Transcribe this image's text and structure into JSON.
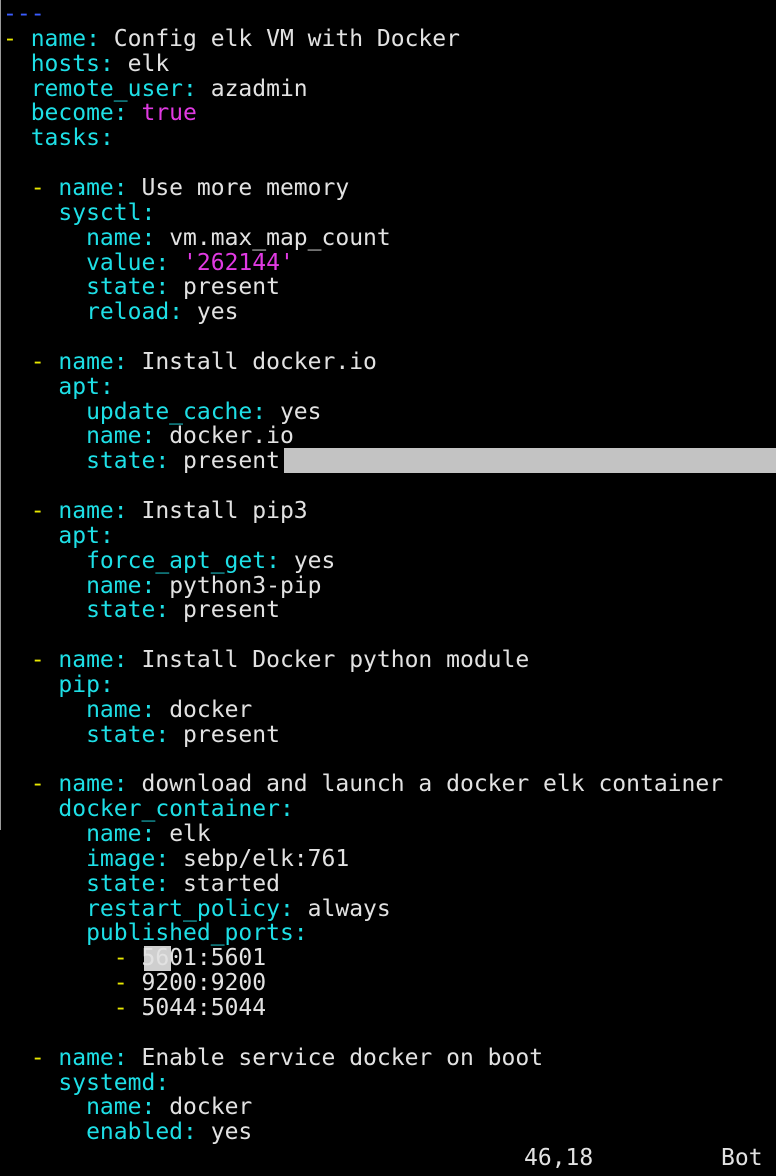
{
  "editor": {
    "lines": [
      [
        {
          "t": "---",
          "c": "doc"
        }
      ],
      [
        {
          "t": "- ",
          "c": "dash"
        },
        {
          "t": "name",
          "c": "key"
        },
        {
          "t": ": ",
          "c": "key"
        },
        {
          "t": "Config elk VM with Docker",
          "c": "val"
        }
      ],
      [
        {
          "t": "  hosts",
          "c": "key"
        },
        {
          "t": ": ",
          "c": "key"
        },
        {
          "t": "elk",
          "c": "val"
        }
      ],
      [
        {
          "t": "  remote_user",
          "c": "key"
        },
        {
          "t": ": ",
          "c": "key"
        },
        {
          "t": "azadmin",
          "c": "val"
        }
      ],
      [
        {
          "t": "  become",
          "c": "key"
        },
        {
          "t": ": ",
          "c": "key"
        },
        {
          "t": "true",
          "c": "bool"
        }
      ],
      [
        {
          "t": "  tasks",
          "c": "key"
        },
        {
          "t": ":",
          "c": "key"
        }
      ],
      [],
      [
        {
          "t": "  - ",
          "c": "dash"
        },
        {
          "t": "name",
          "c": "key"
        },
        {
          "t": ": ",
          "c": "key"
        },
        {
          "t": "Use more memory",
          "c": "val"
        }
      ],
      [
        {
          "t": "    sysctl",
          "c": "key"
        },
        {
          "t": ":",
          "c": "key"
        }
      ],
      [
        {
          "t": "      name",
          "c": "key"
        },
        {
          "t": ": ",
          "c": "key"
        },
        {
          "t": "vm.max_map_count",
          "c": "val"
        }
      ],
      [
        {
          "t": "      value",
          "c": "key"
        },
        {
          "t": ": ",
          "c": "key"
        },
        {
          "t": "'262144'",
          "c": "str"
        }
      ],
      [
        {
          "t": "      state",
          "c": "key"
        },
        {
          "t": ": ",
          "c": "key"
        },
        {
          "t": "present",
          "c": "val"
        }
      ],
      [
        {
          "t": "      reload",
          "c": "key"
        },
        {
          "t": ": ",
          "c": "key"
        },
        {
          "t": "yes",
          "c": "val"
        }
      ],
      [],
      [
        {
          "t": "  - ",
          "c": "dash"
        },
        {
          "t": "name",
          "c": "key"
        },
        {
          "t": ": ",
          "c": "key"
        },
        {
          "t": "Install docker.io",
          "c": "val"
        }
      ],
      [
        {
          "t": "    apt",
          "c": "key"
        },
        {
          "t": ":",
          "c": "key"
        }
      ],
      [
        {
          "t": "      update_cache",
          "c": "key"
        },
        {
          "t": ": ",
          "c": "key"
        },
        {
          "t": "yes",
          "c": "val"
        }
      ],
      [
        {
          "t": "      name",
          "c": "key"
        },
        {
          "t": ": ",
          "c": "key"
        },
        {
          "t": "docker.io",
          "c": "val"
        }
      ],
      [
        {
          "t": "      state",
          "c": "key"
        },
        {
          "t": ": ",
          "c": "key"
        },
        {
          "t": "present",
          "c": "val"
        }
      ],
      [],
      [
        {
          "t": "  - ",
          "c": "dash"
        },
        {
          "t": "name",
          "c": "key"
        },
        {
          "t": ": ",
          "c": "key"
        },
        {
          "t": "Install pip3",
          "c": "val"
        }
      ],
      [
        {
          "t": "    apt",
          "c": "key"
        },
        {
          "t": ":",
          "c": "key"
        }
      ],
      [
        {
          "t": "      force_apt_get",
          "c": "key"
        },
        {
          "t": ": ",
          "c": "key"
        },
        {
          "t": "yes",
          "c": "val"
        }
      ],
      [
        {
          "t": "      name",
          "c": "key"
        },
        {
          "t": ": ",
          "c": "key"
        },
        {
          "t": "python3-pip",
          "c": "val"
        }
      ],
      [
        {
          "t": "      state",
          "c": "key"
        },
        {
          "t": ": ",
          "c": "key"
        },
        {
          "t": "present",
          "c": "val"
        }
      ],
      [],
      [
        {
          "t": "  - ",
          "c": "dash"
        },
        {
          "t": "name",
          "c": "key"
        },
        {
          "t": ": ",
          "c": "key"
        },
        {
          "t": "Install Docker python module",
          "c": "val"
        }
      ],
      [
        {
          "t": "    pip",
          "c": "key"
        },
        {
          "t": ":",
          "c": "key"
        }
      ],
      [
        {
          "t": "      name",
          "c": "key"
        },
        {
          "t": ": ",
          "c": "key"
        },
        {
          "t": "docker",
          "c": "val"
        }
      ],
      [
        {
          "t": "      state",
          "c": "key"
        },
        {
          "t": ": ",
          "c": "key"
        },
        {
          "t": "present",
          "c": "val"
        }
      ],
      [],
      [
        {
          "t": "  - ",
          "c": "dash"
        },
        {
          "t": "name",
          "c": "key"
        },
        {
          "t": ": ",
          "c": "key"
        },
        {
          "t": "download and launch a docker elk container",
          "c": "val"
        }
      ],
      [
        {
          "t": "    docker_container",
          "c": "key"
        },
        {
          "t": ":",
          "c": "key"
        }
      ],
      [
        {
          "t": "      name",
          "c": "key"
        },
        {
          "t": ": ",
          "c": "key"
        },
        {
          "t": "elk",
          "c": "val"
        }
      ],
      [
        {
          "t": "      image",
          "c": "key"
        },
        {
          "t": ": ",
          "c": "key"
        },
        {
          "t": "sebp/elk:761",
          "c": "val"
        }
      ],
      [
        {
          "t": "      state",
          "c": "key"
        },
        {
          "t": ": ",
          "c": "key"
        },
        {
          "t": "started",
          "c": "val"
        }
      ],
      [
        {
          "t": "      restart_policy",
          "c": "key"
        },
        {
          "t": ": ",
          "c": "key"
        },
        {
          "t": "always",
          "c": "val"
        }
      ],
      [
        {
          "t": "      published_ports",
          "c": "key"
        },
        {
          "t": ":",
          "c": "key"
        }
      ],
      [
        {
          "t": "        - ",
          "c": "dash"
        },
        {
          "t": "5601:5601",
          "c": "val"
        }
      ],
      [
        {
          "t": "        - ",
          "c": "dash"
        },
        {
          "t": "9200:9200",
          "c": "val"
        }
      ],
      [
        {
          "t": "        - ",
          "c": "dash"
        },
        {
          "t": "5044:5044",
          "c": "val"
        }
      ],
      [],
      [
        {
          "t": "  - ",
          "c": "dash"
        },
        {
          "t": "name",
          "c": "key"
        },
        {
          "t": ": ",
          "c": "key"
        },
        {
          "t": "Enable service docker on boot",
          "c": "val"
        }
      ],
      [
        {
          "t": "    systemd",
          "c": "key"
        },
        {
          "t": ":",
          "c": "key"
        }
      ],
      [
        {
          "t": "      name",
          "c": "key"
        },
        {
          "t": ": ",
          "c": "key"
        },
        {
          "t": "docker",
          "c": "val"
        }
      ],
      [
        {
          "t": "      enabled",
          "c": "key"
        },
        {
          "t": ": ",
          "c": "key"
        },
        {
          "t": "yes",
          "c": "val"
        }
      ]
    ]
  },
  "statusline": {
    "position": "46,18",
    "scroll": "Bot"
  },
  "colors": {
    "background": "#000000",
    "dash": "#e8e800",
    "key": "#1edfe6",
    "value": "#e2e2e2",
    "boolean": "#e13ae3",
    "string": "#e13ae3",
    "document_marker": "#3a5cff",
    "selection": "#c3c3c3"
  }
}
